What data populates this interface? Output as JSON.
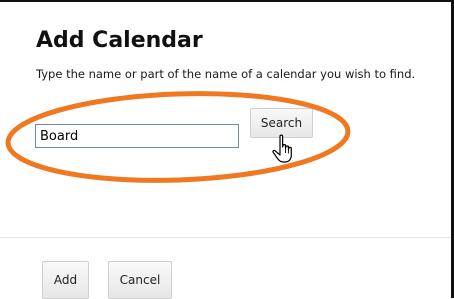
{
  "dialog": {
    "title": "Add Calendar",
    "instruction": "Type the name or part of the name of a calendar you wish to find."
  },
  "search": {
    "value": "Board",
    "button_label": "Search"
  },
  "footer": {
    "add_label": "Add",
    "cancel_label": "Cancel"
  },
  "annotation": {
    "highlight_color": "#F07820",
    "cursor_icon": "hand-pointer-icon"
  },
  "colors": {
    "input_border": "#7a8a9e",
    "button_border": "#cfcfcf"
  }
}
